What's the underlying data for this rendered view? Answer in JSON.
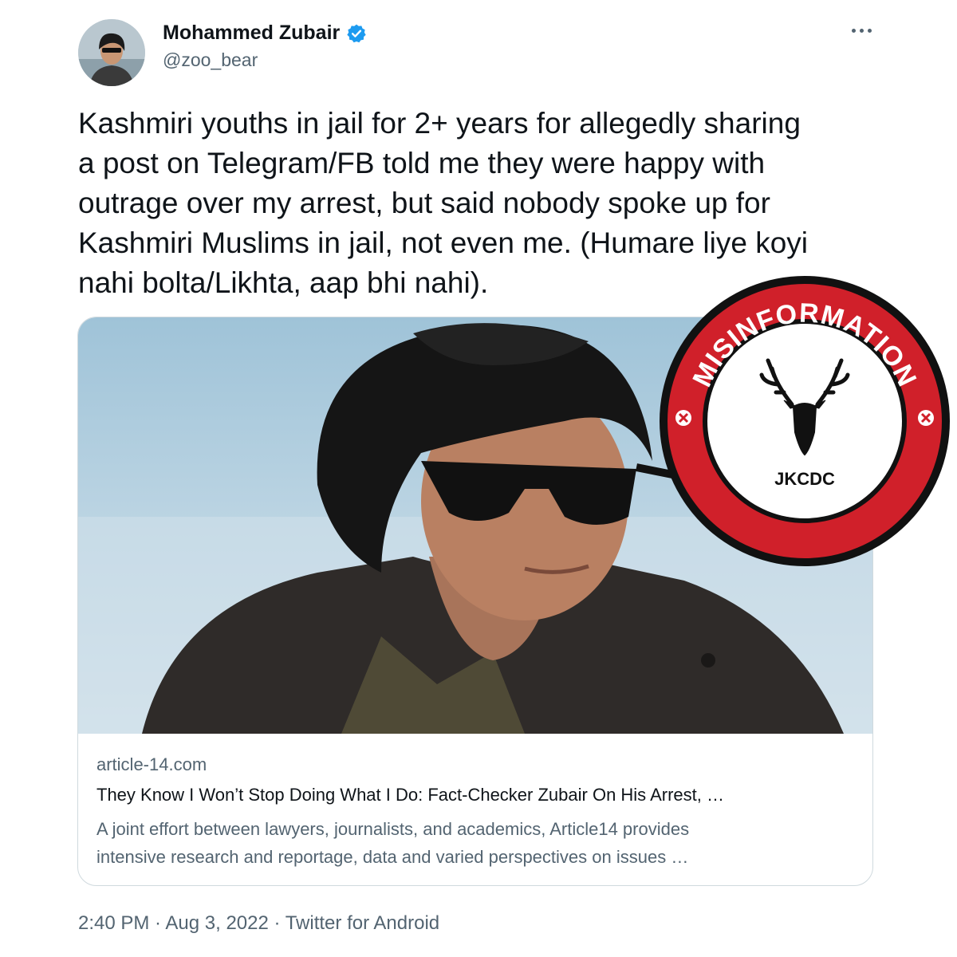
{
  "author": {
    "display_name": "Mohammed Zubair",
    "handle": "@zoo_bear",
    "verified_icon": "verified-badge-icon",
    "avatar_icon": "avatar-photo"
  },
  "menu_icon": "more-options-icon",
  "tweet": {
    "text_lines": [
      "Kashmiri youths in jail for 2+ years for allegedly sharing",
      "a post on Telegram/FB told me they were happy with",
      "outrage over my arrest, but said nobody spoke up for",
      "Kashmiri Muslims in jail, not even me. (Humare liye koyi",
      "nahi bolta/Likhta, aap bhi nahi)."
    ]
  },
  "link_card": {
    "domain": "article-14.com",
    "title": "They Know I Won’t Stop Doing What I Do: Fact-Checker Zubair On His Arrest, …",
    "description_lines": [
      "A joint effort between lawyers, journalists, and academics, Article14 provides",
      "intensive research and reportage, data and varied perspectives on issues …"
    ]
  },
  "timestamp": "2:40 PM · Aug 3, 2022 · Twitter for Android",
  "stamp": {
    "ring_text": "MISINFORMATION",
    "org": "JKCDC",
    "logo_icon": "stag-head-icon",
    "colors": {
      "ring": "#d0202a",
      "outline": "#111111",
      "inner": "#ffffff"
    }
  },
  "colors": {
    "text": "#0f1419",
    "secondary": "#536471",
    "border": "#cfd9de",
    "verified": "#1d9bf0"
  }
}
